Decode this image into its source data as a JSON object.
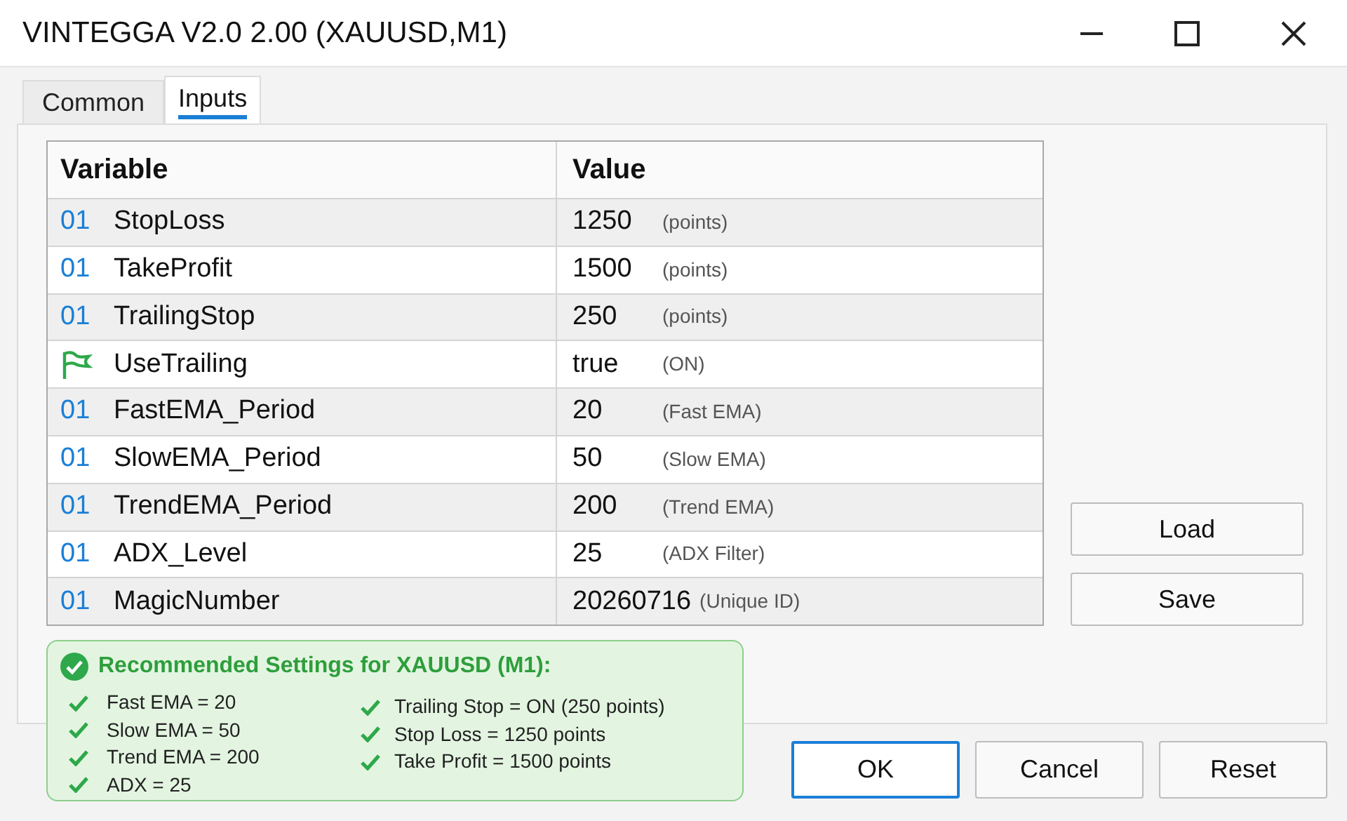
{
  "window": {
    "title": "VINTEGGA V2.0 2.00 (XAUUSD,M1)"
  },
  "tabs": [
    {
      "label": "Common",
      "selected": false
    },
    {
      "label": "Inputs",
      "selected": true
    }
  ],
  "table": {
    "columns": [
      "Variable",
      "Value"
    ],
    "rows": [
      {
        "kind": "number",
        "type_label": "01",
        "name": "StopLoss",
        "value": "1250",
        "note": "(points)"
      },
      {
        "kind": "number",
        "type_label": "01",
        "name": "TakeProfit",
        "value": "1500",
        "note": "(points)"
      },
      {
        "kind": "number",
        "type_label": "01",
        "name": "TrailingStop",
        "value": "250",
        "note": "(points)"
      },
      {
        "kind": "bool",
        "name": "UseTrailing",
        "value": "true",
        "note": "(ON)"
      },
      {
        "kind": "number",
        "type_label": "01",
        "name": "FastEMA_Period",
        "value": "20",
        "note": "(Fast EMA)"
      },
      {
        "kind": "number",
        "type_label": "01",
        "name": "SlowEMA_Period",
        "value": "50",
        "note": "(Slow EMA)"
      },
      {
        "kind": "number",
        "type_label": "01",
        "name": "TrendEMA_Period",
        "value": "200",
        "note": "(Trend EMA)"
      },
      {
        "kind": "number",
        "type_label": "01",
        "name": "ADX_Level",
        "value": "25",
        "note": "(ADX Filter)"
      },
      {
        "kind": "number",
        "type_label": "01",
        "name": "MagicNumber",
        "value": "20260716",
        "note": "(Unique ID)"
      }
    ]
  },
  "side_buttons": [
    "Load",
    "Save"
  ],
  "recommendation": {
    "title": "Recommended Settings for XAUUSD (M1):",
    "left": [
      "Fast EMA = 20",
      "Slow EMA = 50",
      "Trend EMA = 200",
      "ADX = 25"
    ],
    "right": [
      "Trailing Stop = ON (250 points)",
      "Stop Loss = 1250 points",
      "Take Profit = 1500 points"
    ]
  },
  "buttons": [
    {
      "label": "OK",
      "primary": true
    },
    {
      "label": "Cancel",
      "primary": false
    },
    {
      "label": "Reset",
      "primary": false
    }
  ]
}
